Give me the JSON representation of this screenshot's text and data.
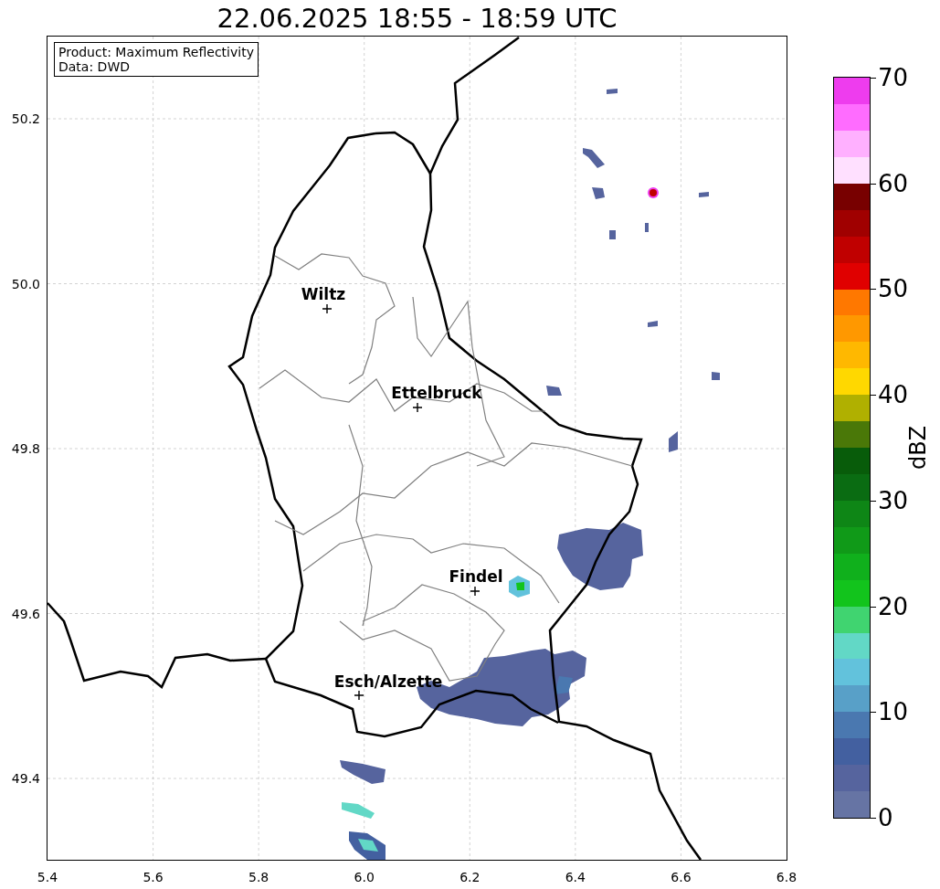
{
  "title": "22.06.2025 18:55 - 18:59 UTC",
  "info_box": {
    "lines": [
      "Product: Maximum Reflectivity",
      "Data: DWD"
    ]
  },
  "map": {
    "x_tick_labels": [
      "5.4",
      "5.6",
      "5.8",
      "6.0",
      "6.2",
      "6.4",
      "6.6",
      "6.8"
    ],
    "y_tick_labels": [
      "50.2",
      "50.0",
      "49.8",
      "49.6",
      "49.4"
    ],
    "places": [
      {
        "name": "Wiltz"
      },
      {
        "name": "Ettelbruck"
      },
      {
        "name": "Findel"
      },
      {
        "name": "Esch/Alzette"
      }
    ]
  },
  "colorbar": {
    "label": "dBZ",
    "tick_labels": [
      "70",
      "60",
      "50",
      "40",
      "30",
      "20",
      "10",
      "0"
    ],
    "segments": [
      {
        "color": "#6674a4"
      },
      {
        "color": "#56649e"
      },
      {
        "color": "#4360a0"
      },
      {
        "color": "#4a78b0"
      },
      {
        "color": "#58a0c8"
      },
      {
        "color": "#62c2dc"
      },
      {
        "color": "#62d8c6"
      },
      {
        "color": "#40d470"
      },
      {
        "color": "#12c41c"
      },
      {
        "color": "#10b01c"
      },
      {
        "color": "#109a18"
      },
      {
        "color": "#0e8616"
      },
      {
        "color": "#0a6c12"
      },
      {
        "color": "#085c0a"
      },
      {
        "color": "#4a7808"
      },
      {
        "color": "#b0b000"
      },
      {
        "color": "#ffd800"
      },
      {
        "color": "#ffb800"
      },
      {
        "color": "#ff9800"
      },
      {
        "color": "#ff7800"
      },
      {
        "color": "#e00000"
      },
      {
        "color": "#c00000"
      },
      {
        "color": "#a00000"
      },
      {
        "color": "#780000"
      },
      {
        "color": "#ffe0ff"
      },
      {
        "color": "#ffb0ff"
      },
      {
        "color": "#ff6cff"
      },
      {
        "color": "#ee3cee"
      }
    ]
  }
}
